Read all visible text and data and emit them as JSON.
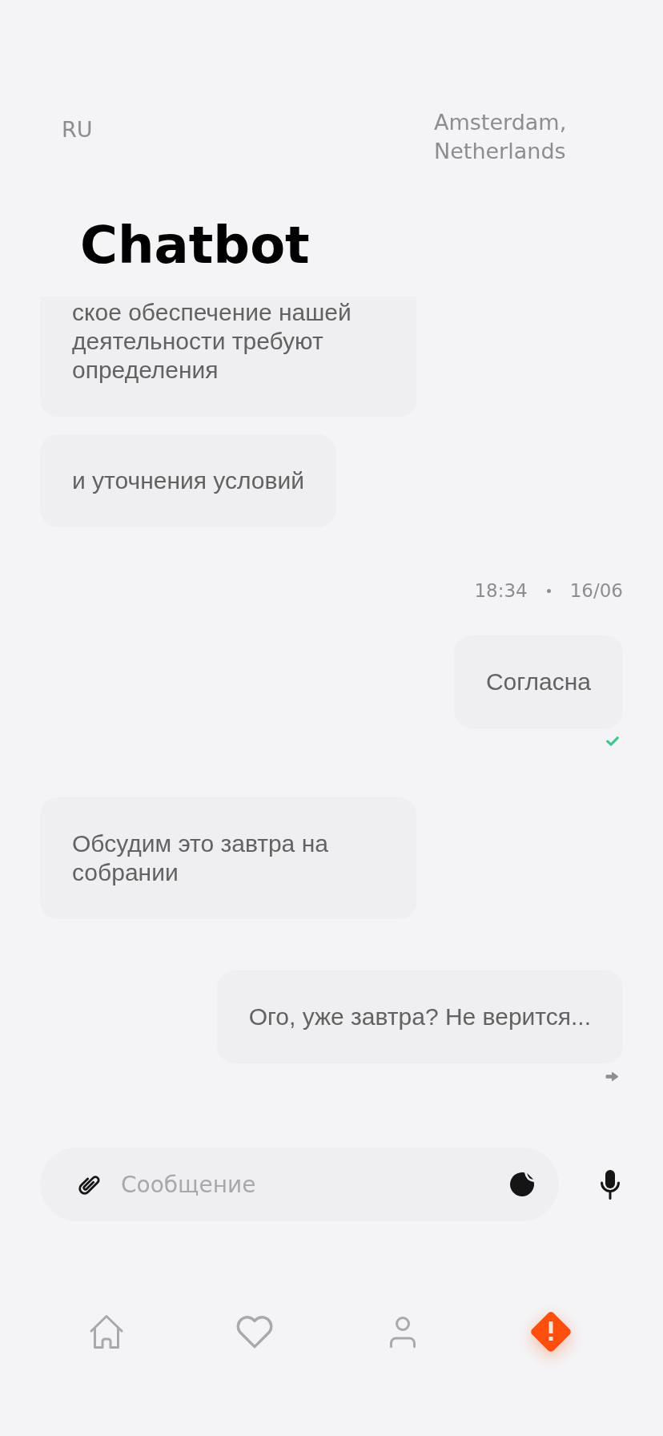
{
  "header": {
    "language": "RU",
    "location": "Amsterdam, Netherlands"
  },
  "title": "Chatbot",
  "messages": [
    {
      "kind": "incoming",
      "text": "ское обеспечение нашей деятельности требуют определения",
      "cut": true
    },
    {
      "kind": "incoming",
      "text": "и уточнения условий",
      "cut": false
    },
    {
      "kind": "timestamp",
      "time": "18:34",
      "date": "16/06"
    },
    {
      "kind": "outgoing",
      "text": "Согласна",
      "cut": false,
      "read": true
    },
    {
      "kind": "incoming",
      "text": "Обсудим это завтра на собрании",
      "cut": false
    },
    {
      "kind": "outgoing",
      "text": "Ого, уже завтра? Не верится...",
      "cut": false,
      "read": false
    }
  ],
  "composer": {
    "placeholder": "Сообщение"
  },
  "nav": [
    {
      "kind": "home",
      "selected": false
    },
    {
      "kind": "favorites",
      "selected": false
    },
    {
      "kind": "profile",
      "selected": false
    },
    {
      "kind": "alert",
      "selected": true
    }
  ]
}
